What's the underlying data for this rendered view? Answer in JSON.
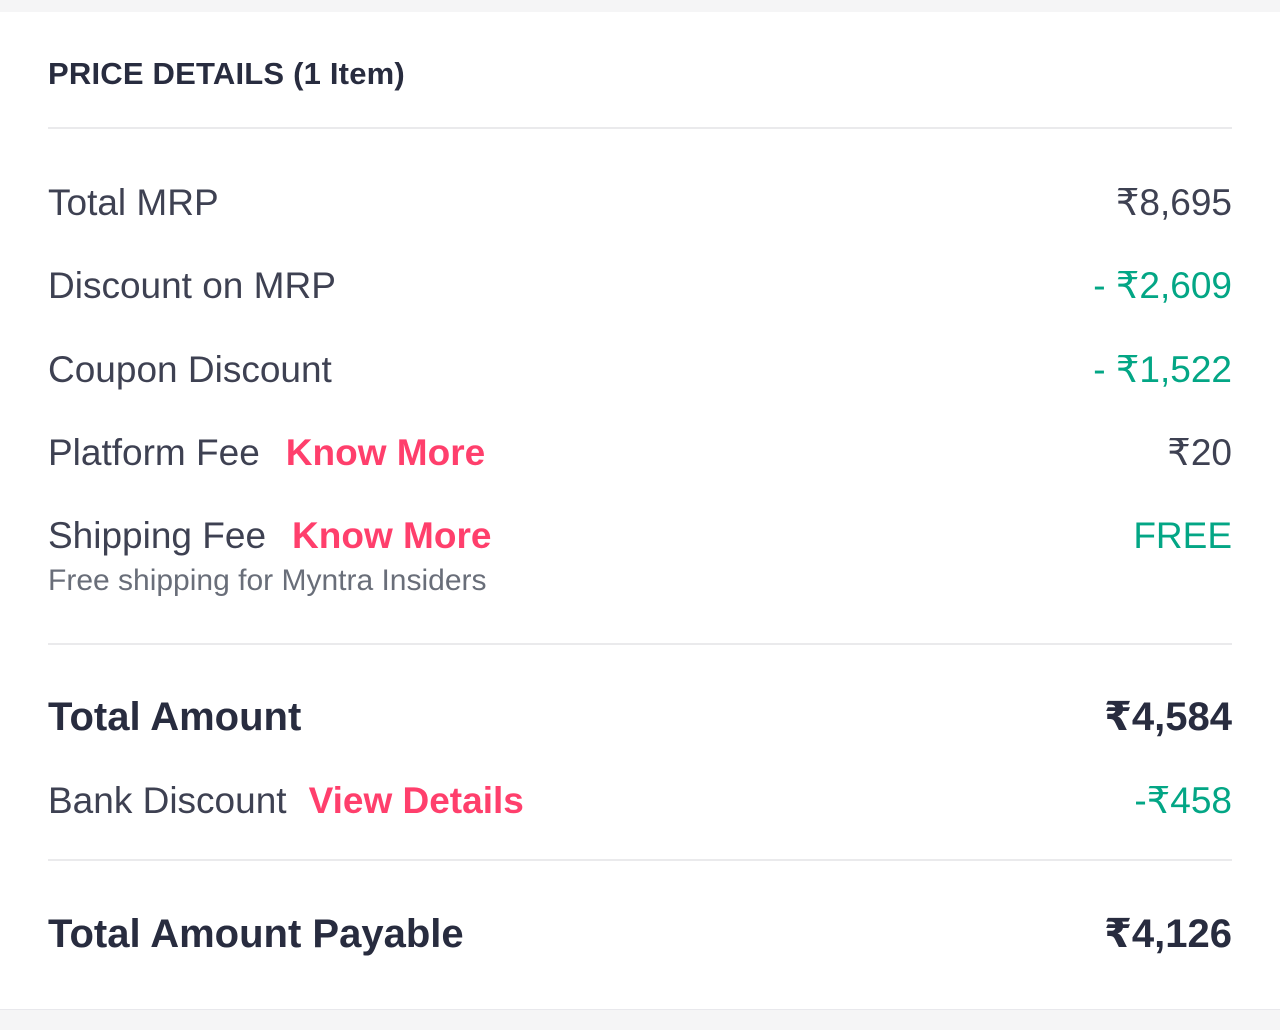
{
  "header": {
    "title": "PRICE DETAILS (1 Item)"
  },
  "rows": {
    "total_mrp": {
      "label": "Total MRP",
      "value": "₹8,695"
    },
    "discount_mrp": {
      "label": "Discount on MRP",
      "value": "- ₹2,609"
    },
    "coupon_discount": {
      "label": "Coupon Discount",
      "value": "- ₹1,522"
    },
    "platform_fee": {
      "label": "Platform Fee",
      "link": "Know More",
      "value": "₹20"
    },
    "shipping_fee": {
      "label": "Shipping Fee",
      "link": "Know More",
      "value": "FREE",
      "note": "Free shipping for Myntra Insiders"
    },
    "total_amount": {
      "label": "Total Amount",
      "value": "₹4,584"
    },
    "bank_discount": {
      "label": "Bank Discount",
      "link": "View Details",
      "value": "-₹458"
    },
    "total_payable": {
      "label": "Total Amount Payable",
      "value": "₹4,126"
    }
  },
  "colors": {
    "accent_link": "#ff3f6c",
    "discount_green": "#03a685",
    "text_dark": "#282c3f",
    "text_body": "#3e4152"
  }
}
